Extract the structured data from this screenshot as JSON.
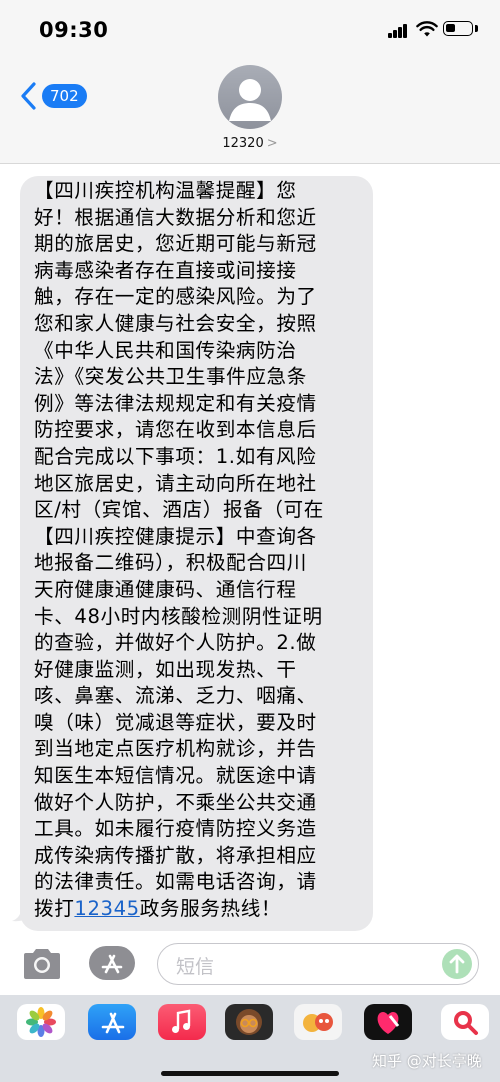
{
  "status_bar": {
    "time": "09:30"
  },
  "header": {
    "back_count": "702",
    "contact_name": "12320",
    "contact_chevron": ">"
  },
  "message": {
    "lines": [
      "【四川疾控机构温馨提醒】您",
      "好！根据通信大数据分析和您近",
      "期的旅居史，您近期可能与新冠",
      "病毒感染者存在直接或间接接",
      "触，存在一定的感染风险。为了",
      "您和家人健康与社会安全，按照",
      "《中华人民共和国传染病防治",
      "法》《突发公共卫生事件应急条",
      "例》等法律法规规定和有关疫情",
      "防控要求，请您在收到本信息后",
      "配合完成以下事项：1.如有风险",
      "地区旅居史，请主动向所在地社",
      "区/村（宾馆、酒店）报备（可在",
      "【四川疾控健康提示】中查询各",
      "地报备二维码），积极配合四川",
      "天府健康通健康码、通信行程",
      "卡、48小时内核酸检测阴性证明",
      "的查验，并做好个人防护。2.做",
      "好健康监测，如出现发热、干",
      "咳、鼻塞、流涕、乏力、咽痛、",
      "嗅（味）觉减退等症状，要及时",
      "到当地定点医疗机构就诊，并告",
      "知医生本短信情况。就医途中请",
      "做好个人防护，不乘坐公共交通",
      "工具。如未履行疫情防控义务造",
      "成传染病传播扩散，将承担相应",
      "的法律责任。如需电话咨询，请"
    ],
    "last_line_prefix": "拨打",
    "hotline": "12345",
    "last_line_suffix": "政务服务热线！"
  },
  "input": {
    "placeholder": "短信"
  },
  "drawer": {
    "apps": [
      "photos-app",
      "appstore-app",
      "music-app",
      "memoji-app",
      "memoji-stickers-app",
      "heart-app",
      "search-app"
    ]
  },
  "watermark": "知乎 @对长亭晚"
}
